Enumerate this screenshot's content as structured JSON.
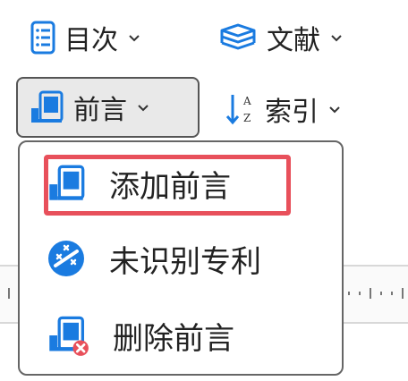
{
  "toolbar": {
    "toc": {
      "label": "目次",
      "icon": "table-of-contents-icon"
    },
    "references": {
      "label": "文献",
      "icon": "books-stack-icon"
    },
    "preface": {
      "label": "前言",
      "icon": "book-icon"
    },
    "index": {
      "label": "索引",
      "icon": "sort-az-icon"
    }
  },
  "dropdown": {
    "items": [
      {
        "label": "添加前言",
        "icon": "book-add-icon",
        "highlighted": true
      },
      {
        "label": "未识别专利",
        "icon": "unrecognized-patent-icon"
      },
      {
        "label": "删除前言",
        "icon": "book-delete-icon"
      }
    ]
  },
  "colors": {
    "accent": "#1a7be0",
    "highlight": "#e8505b",
    "delete": "#e8505b",
    "active_bg": "#e9e9e9"
  }
}
